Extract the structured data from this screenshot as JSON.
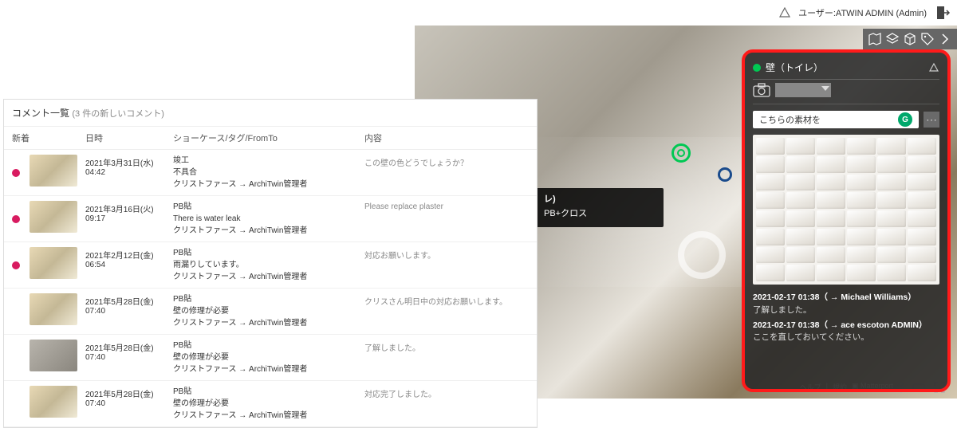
{
  "header": {
    "user_prefix": "ユーザー:",
    "user_name": "ATWIN ADMIN (Admin)"
  },
  "comment_panel": {
    "title": "コメント一覧",
    "subtitle": "(3 件の新しいコメント)",
    "columns": {
      "new": "新着",
      "date": "日時",
      "showcase": "ショーケース/タグ/FromTo",
      "body": "内容"
    },
    "rows": [
      {
        "is_new": true,
        "thumb": "room",
        "date": "2021年3月31日(水) 04:42",
        "tag": "竣工",
        "subject": "不具合",
        "fromto": "クリストファース → ArchiTwin管理者",
        "body": "この壁の色どうでしょうか？"
      },
      {
        "is_new": true,
        "thumb": "room",
        "date": "2021年3月16日(火) 09:17",
        "tag": "PB貼",
        "subject": "There is water leak",
        "fromto": "クリストファース → ArchiTwin管理者",
        "body": "Please replace plaster"
      },
      {
        "is_new": true,
        "thumb": "room",
        "date": "2021年2月12日(金) 06:54",
        "tag": "PB貼",
        "subject": "雨漏りしています。",
        "fromto": "クリストファース → ArchiTwin管理者",
        "body": "対応お願いします。"
      },
      {
        "is_new": false,
        "thumb": "room",
        "date": "2021年5月28日(金) 07:40",
        "tag": "PB貼",
        "subject": "壁の修理が必要",
        "fromto": "クリストファース → ArchiTwin管理者",
        "body": "クリスさん明日中の対応お願いします。"
      },
      {
        "is_new": false,
        "thumb": "gray",
        "date": "2021年5月28日(金) 07:40",
        "tag": "PB貼",
        "subject": "壁の修理が必要",
        "fromto": "クリストファース → ArchiTwin管理者",
        "body": "了解しました。"
      },
      {
        "is_new": false,
        "thumb": "room",
        "date": "2021年5月28日(金) 07:40",
        "tag": "PB貼",
        "subject": "壁の修理が必要",
        "fromto": "クリストファース → ArchiTwin管理者",
        "body": "対応完了しました。"
      }
    ]
  },
  "viewer_label": {
    "line1": "レ)",
    "line2": "PB+クロス"
  },
  "detail_panel": {
    "title": "壁（トイレ）",
    "input_value": "こちらの素材を",
    "grammar_badge": "G",
    "messages": [
      {
        "head": "2021-02-17 01:38（ → Michael Williams）",
        "body": "了解しました。"
      },
      {
        "head": "2021-02-17 01:38（ → ace escoton ADMIN）",
        "body": "ここを直しておいてください。"
      }
    ]
  },
  "footer_links": {
    "help": "ヘルプ",
    "terms": "規約",
    "brand": "Matterport"
  }
}
